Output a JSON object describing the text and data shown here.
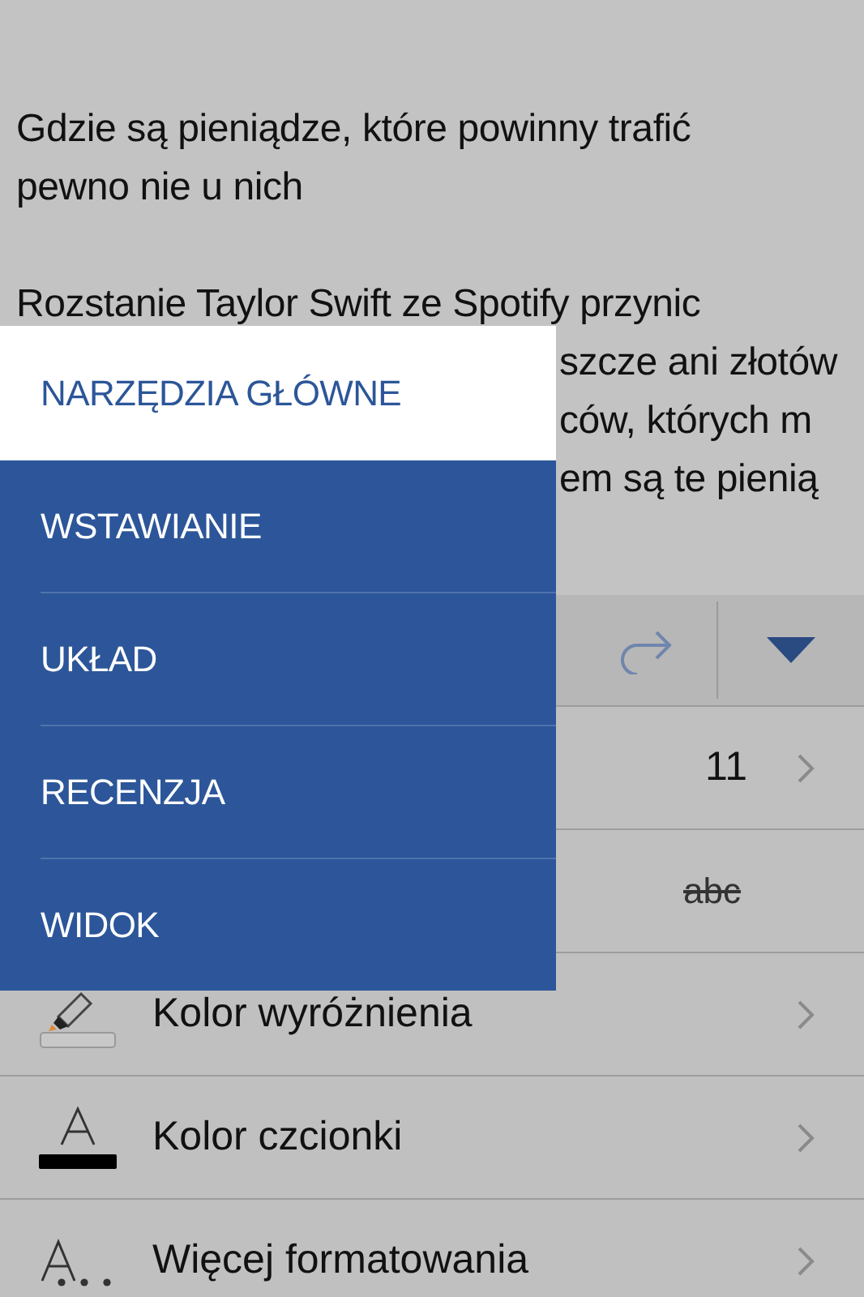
{
  "document": {
    "paragraphs": [
      {
        "lines": [
          {
            "kind": "full",
            "text": "Gdzie są pieniądze, które powinny trafić"
          },
          {
            "kind": "full",
            "text": "pewno nie u nich"
          }
        ]
      },
      {
        "lines": [
          {
            "kind": "full",
            "text": "Rozstanie Taylor Swift ze Spotify przynic"
          },
          {
            "kind": "tail",
            "text": "szcze ani złotów"
          },
          {
            "kind": "tail",
            "text": "ców, których m"
          },
          {
            "kind": "tail",
            "text": "em są te pienią"
          }
        ]
      }
    ]
  },
  "ribbon_menu": {
    "tabs": [
      {
        "label": "NARZĘDZIA GŁÓWNE",
        "selected": true
      },
      {
        "label": "WSTAWIANIE",
        "selected": false
      },
      {
        "label": "UKŁAD",
        "selected": false
      },
      {
        "label": "RECENZJA",
        "selected": false
      },
      {
        "label": "WIDOK",
        "selected": false
      }
    ]
  },
  "format_panel": {
    "rows": [
      {
        "kind": "value",
        "value": "11"
      },
      {
        "kind": "preview",
        "value": "abc"
      },
      {
        "kind": "nav",
        "label": "Kolor wyróżnienia"
      },
      {
        "kind": "nav",
        "label": "Kolor czcionki"
      },
      {
        "kind": "nav",
        "label": "Więcej formatowania"
      }
    ]
  }
}
